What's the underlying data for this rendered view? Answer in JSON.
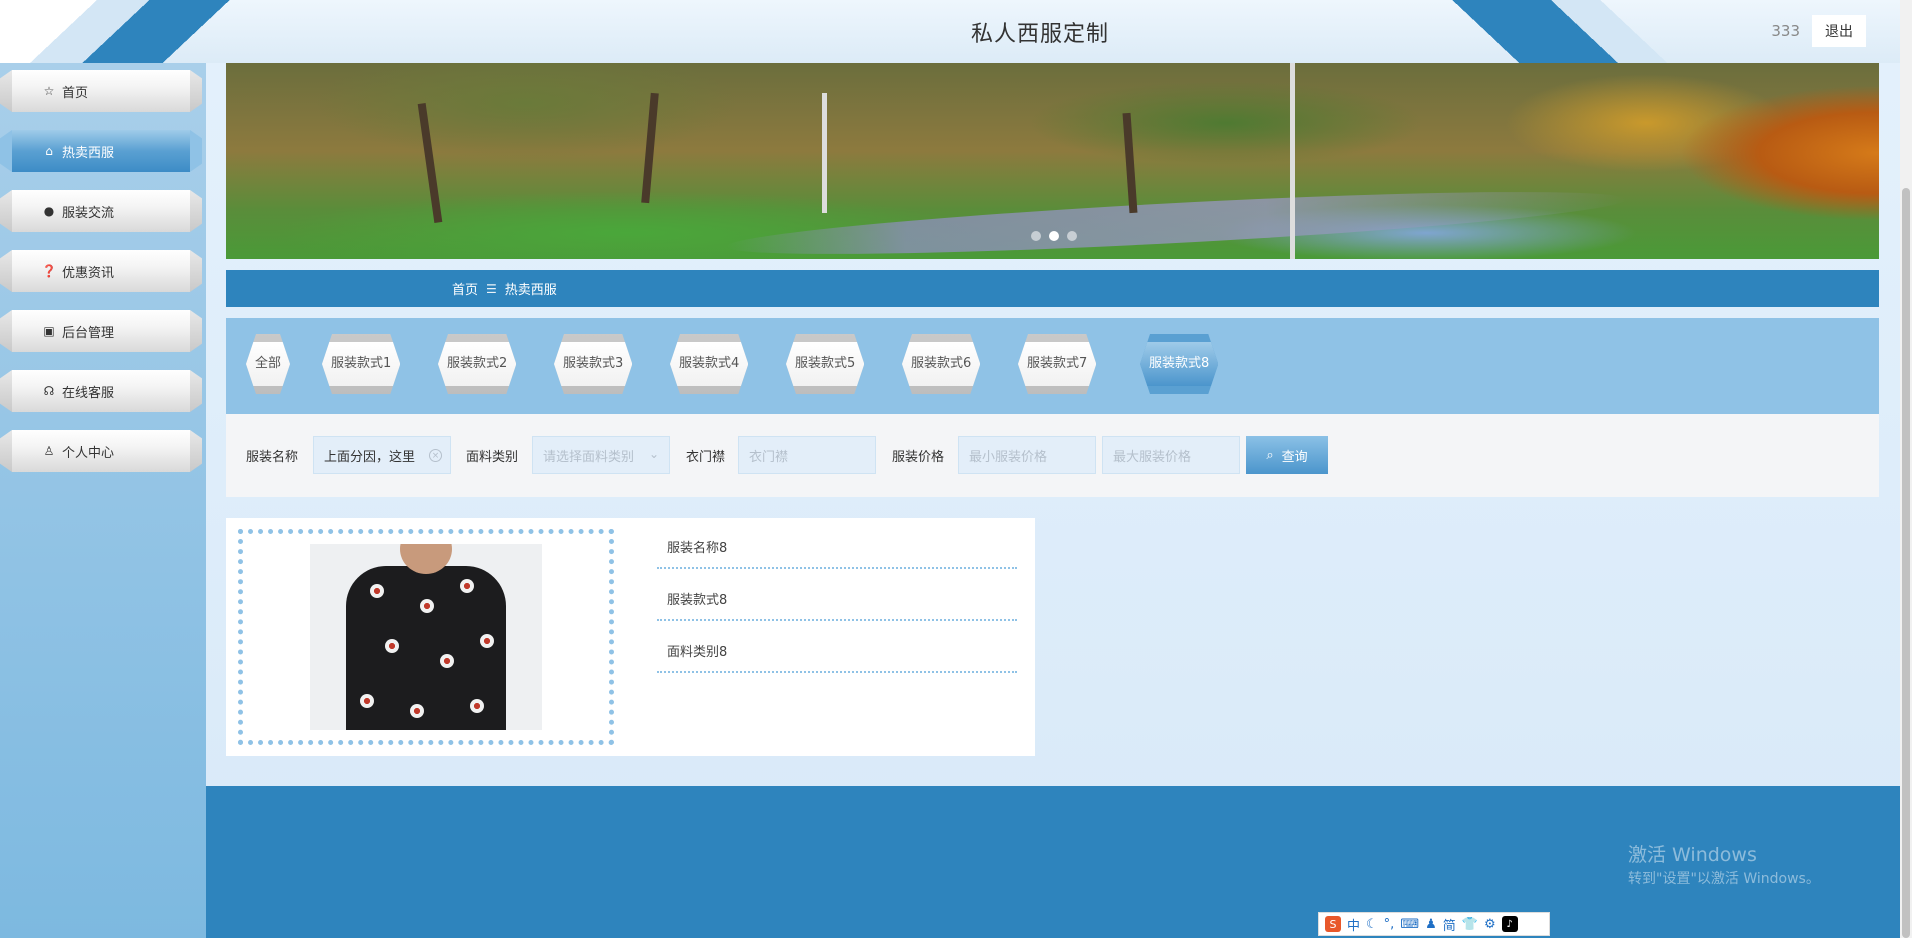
{
  "header": {
    "title": "私人西服定制",
    "user": "333",
    "logout_label": "退出"
  },
  "sidebar": {
    "items": [
      {
        "label": "首页",
        "icon": "star-icon",
        "active": false
      },
      {
        "label": "热卖西服",
        "icon": "bag-icon",
        "active": true
      },
      {
        "label": "服装交流",
        "icon": "alert-icon",
        "active": false
      },
      {
        "label": "优惠资讯",
        "icon": "help-icon",
        "active": false
      },
      {
        "label": "后台管理",
        "icon": "briefcase-icon",
        "active": false
      },
      {
        "label": "在线客服",
        "icon": "headset-icon",
        "active": false
      },
      {
        "label": "个人中心",
        "icon": "user-icon",
        "active": false
      }
    ]
  },
  "banner": {
    "slide_count": 3,
    "active_slide": 2
  },
  "breadcrumb": {
    "home": "首页",
    "separator": "☰",
    "current": "热卖西服"
  },
  "categories": {
    "items": [
      "全部",
      "服装款式1",
      "服装款式2",
      "服装款式3",
      "服装款式4",
      "服装款式5",
      "服装款式6",
      "服装款式7",
      "服装款式8"
    ],
    "active": "服装款式8"
  },
  "search": {
    "name_label": "服装名称",
    "name_value": "上面分因，这里",
    "fabric_label": "面料类别",
    "fabric_placeholder": "请选择面料类别",
    "placket_label": "衣门襟",
    "placket_placeholder": "衣门襟",
    "price_label": "服装价格",
    "min_price_placeholder": "最小服装价格",
    "max_price_placeholder": "最大服装价格",
    "query_label": "查询"
  },
  "product": {
    "name": "服装名称8",
    "style": "服装款式8",
    "fabric": "面料类别8"
  },
  "os": {
    "watermark_title": "激活 Windows",
    "watermark_sub": "转到\"设置\"以激活 Windows。",
    "ime_items": [
      "中",
      "简"
    ]
  },
  "colors": {
    "primary": "#2e84bd",
    "accent_light": "#8fc2e6",
    "footer": "#2e84bd"
  }
}
